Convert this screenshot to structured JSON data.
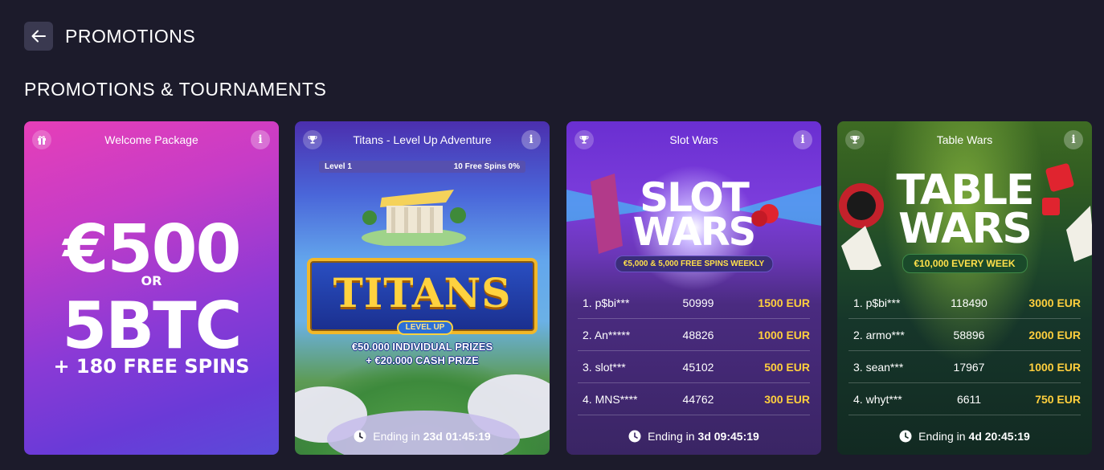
{
  "header": {
    "title": "PROMOTIONS"
  },
  "section": {
    "title": "PROMOTIONS & TOURNAMENTS"
  },
  "cards": [
    {
      "name": "Welcome Package",
      "icon": "gift-icon",
      "hero": {
        "line1": "€500",
        "or": "OR",
        "line2": "5BTC",
        "line3": "+ 180 FREE SPINS"
      }
    },
    {
      "name": "Titans - Level Up Adventure",
      "icon": "trophy-icon",
      "level": {
        "label": "Level 1",
        "progress_text": "10 Free Spins 0%"
      },
      "banner": {
        "title": "TITANS",
        "badge": "LEVEL UP",
        "prize1": "€50.000 INDIVIDUAL PRIZES",
        "prize2": "+ €20.000 CASH PRIZE"
      },
      "ending": {
        "label": "Ending in",
        "time": "23d 01:45:19"
      }
    },
    {
      "name": "Slot Wars",
      "icon": "trophy-icon",
      "banner": {
        "title1": "SLOT",
        "title2": "WARS",
        "subtitle": "€5,000 & 5,000 FREE SPINS WEEKLY"
      },
      "leaderboard": [
        {
          "rank": "1.",
          "name": "p$bi***",
          "score": "50999",
          "prize": "1500 EUR"
        },
        {
          "rank": "2.",
          "name": "An*****",
          "score": "48826",
          "prize": "1000 EUR"
        },
        {
          "rank": "3.",
          "name": "slot***",
          "score": "45102",
          "prize": "500 EUR"
        },
        {
          "rank": "4.",
          "name": "MNS****",
          "score": "44762",
          "prize": "300 EUR"
        }
      ],
      "ending": {
        "label": "Ending in",
        "time": "3d 09:45:19"
      }
    },
    {
      "name": "Table Wars",
      "icon": "trophy-icon",
      "banner": {
        "title1": "TABLE",
        "title2": "WARS",
        "subtitle": "€10,000 EVERY WEEK"
      },
      "leaderboard": [
        {
          "rank": "1.",
          "name": "p$bi***",
          "score": "118490",
          "prize": "3000 EUR"
        },
        {
          "rank": "2.",
          "name": "armo***",
          "score": "58896",
          "prize": "2000 EUR"
        },
        {
          "rank": "3.",
          "name": "sean***",
          "score": "17967",
          "prize": "1000 EUR"
        },
        {
          "rank": "4.",
          "name": "whyt***",
          "score": "6611",
          "prize": "750 EUR"
        }
      ],
      "ending": {
        "label": "Ending in",
        "time": "4d 20:45:19"
      }
    }
  ],
  "colors": {
    "background": "#1c1b2b",
    "prize": "#ffcf3d",
    "accent_pink": "#e63fb8"
  }
}
